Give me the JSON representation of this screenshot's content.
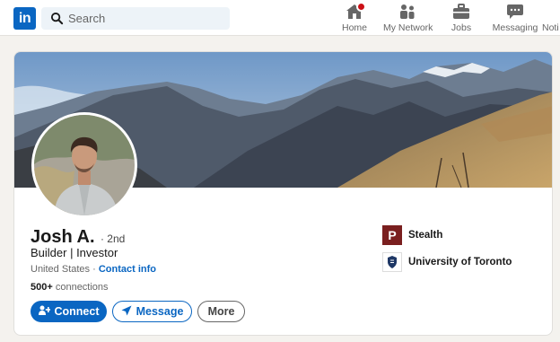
{
  "nav": {
    "logo_text": "in",
    "search_placeholder": "Search",
    "items": [
      {
        "label": "Home",
        "icon": "home-icon"
      },
      {
        "label": "My Network",
        "icon": "network-icon"
      },
      {
        "label": "Jobs",
        "icon": "briefcase-icon"
      },
      {
        "label": "Messaging",
        "icon": "messaging-icon"
      },
      {
        "label": "Noti",
        "icon": "bell-icon"
      }
    ]
  },
  "profile": {
    "name": "Josh A.",
    "degree": "· 2nd",
    "headline": "Builder | Investor",
    "location": "United States",
    "separator": " · ",
    "contact_label": "Contact info",
    "connections_count": "500+",
    "connections_label": " connections",
    "buttons": {
      "connect": "Connect",
      "message": "Message",
      "more": "More"
    }
  },
  "experience": [
    {
      "name": "Stealth",
      "logo_text": "P"
    },
    {
      "name": "University of Toronto"
    }
  ],
  "colors": {
    "brand": "#0a66c2",
    "badge": "#cc1016",
    "page_bg": "#f4f2ee"
  }
}
